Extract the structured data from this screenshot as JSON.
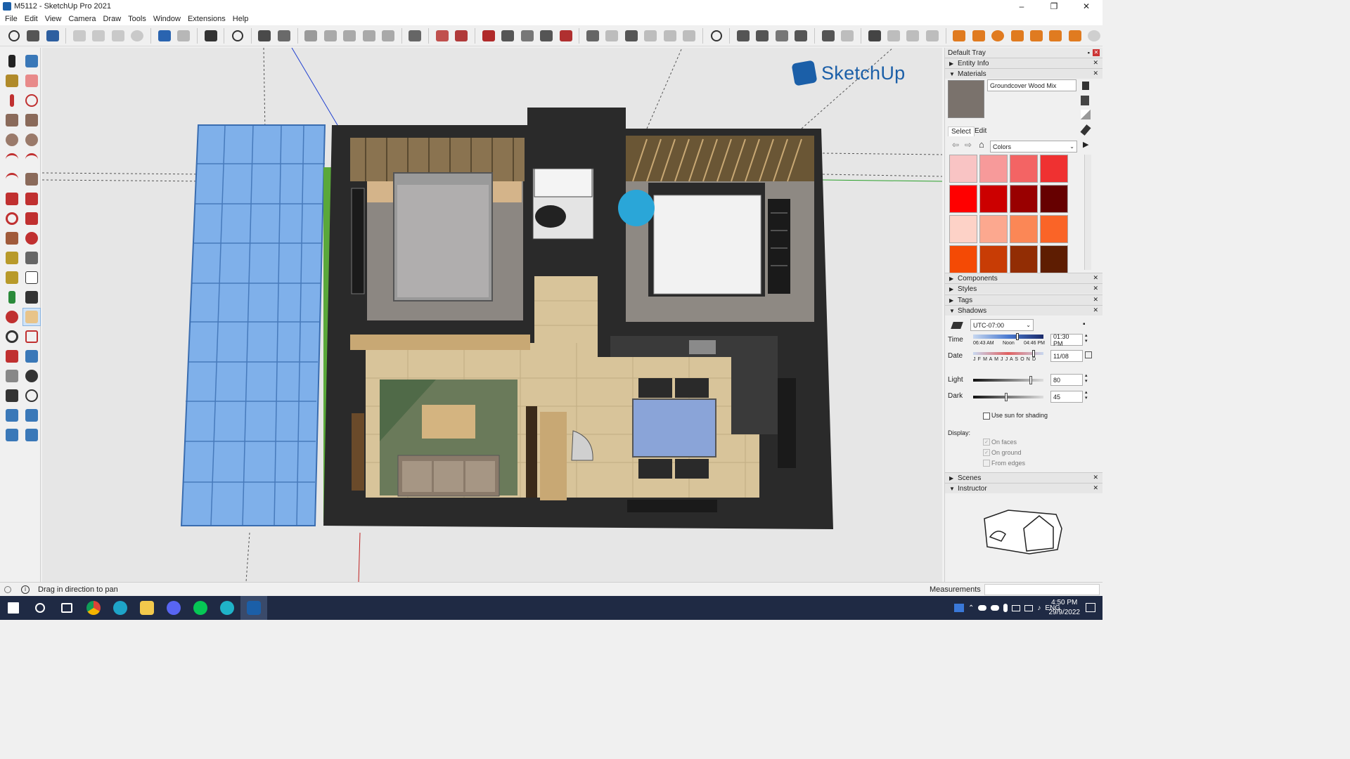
{
  "window": {
    "title": "M5112 - SketchUp Pro 2021",
    "minimize": "–",
    "maximize": "❐",
    "close": "✕"
  },
  "menu": [
    "File",
    "Edit",
    "View",
    "Camera",
    "Draw",
    "Tools",
    "Window",
    "Extensions",
    "Help"
  ],
  "logo": {
    "text": "SketchUp"
  },
  "tray": {
    "title": "Default Tray",
    "entity_info": "Entity Info",
    "materials": "Materials",
    "material_name": "Groundcover Wood Mix",
    "select_tab": "Select",
    "edit_tab": "Edit",
    "library": "Colors",
    "swatches": [
      "#f9c4c4",
      "#f79a9a",
      "#f36464",
      "#ef3131",
      "#ff0000",
      "#cc0000",
      "#990000",
      "#660000",
      "#fdd2c7",
      "#fca88f",
      "#fb8756",
      "#fa6427",
      "#f44a05",
      "#c83c05",
      "#922d04",
      "#5e1d02"
    ],
    "components": "Components",
    "styles": "Styles",
    "tags": "Tags",
    "shadows": "Shadows",
    "timezone": "UTC-07:00",
    "time_label": "Time",
    "time_start": "06:43 AM",
    "time_noon": "Noon",
    "time_end": "04:46 PM",
    "time_value": "01:30 PM",
    "date_label": "Date",
    "months": "J F M A M J J A S O N D",
    "date_value": "11/08",
    "light_label": "Light",
    "light_value": "80",
    "light_level": 0.8,
    "dark_label": "Dark",
    "dark_value": "45",
    "dark_level": 0.45,
    "use_sun": "Use sun for shading",
    "display_label": "Display:",
    "on_faces": "On faces",
    "on_ground": "On ground",
    "from_edges": "From edges",
    "scenes": "Scenes",
    "instructor": "Instructor"
  },
  "status": {
    "message": "Drag in direction to pan",
    "measurements": "Measurements"
  },
  "taskbar": {
    "lang": "ENG",
    "time": "4:50 PM",
    "date": "29/9/2022"
  }
}
